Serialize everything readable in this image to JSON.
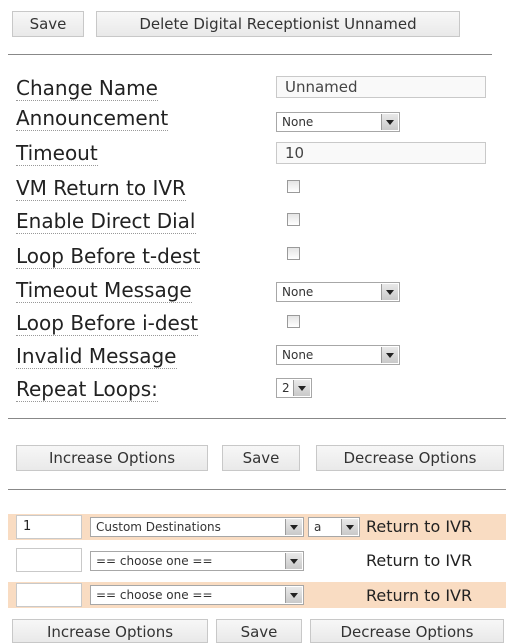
{
  "top_toolbar": {
    "save_label": "Save",
    "delete_label": "Delete Digital Receptionist Unnamed"
  },
  "form": {
    "change_name_label": "Change Name",
    "change_name_value": "Unnamed",
    "announcement_label": "Announcement",
    "announcement_value": "None",
    "timeout_label": "Timeout",
    "timeout_value": "10",
    "vm_return_label": "VM Return to IVR",
    "vm_return_checked": false,
    "enable_direct_dial_label": "Enable Direct Dial",
    "enable_direct_dial_checked": false,
    "loop_before_tdest_label": "Loop Before t-dest",
    "loop_before_tdest_checked": false,
    "timeout_message_label": "Timeout Message",
    "timeout_message_value": "None",
    "loop_before_idest_label": "Loop Before i-dest",
    "loop_before_idest_checked": false,
    "invalid_message_label": "Invalid Message",
    "invalid_message_value": "None",
    "repeat_loops_label": "Repeat Loops:",
    "repeat_loops_value": "2"
  },
  "options_toolbar": {
    "increase_label": "Increase Options",
    "save_label": "Save",
    "decrease_label": "Decrease Options"
  },
  "option_rows": [
    {
      "digit": "1",
      "destination": "Custom Destinations",
      "sub_value": "a",
      "return_label": "Return to IVR"
    },
    {
      "digit": "",
      "destination": "== choose one ==",
      "return_label": "Return to IVR"
    },
    {
      "digit": "",
      "destination": "== choose one ==",
      "return_label": "Return to IVR"
    }
  ],
  "bottom_toolbar": {
    "increase_label": "Increase Options",
    "save_label": "Save",
    "decrease_label": "Decrease Options"
  },
  "colors": {
    "row_highlight": "#f9dcc2",
    "divider": "#888888"
  }
}
